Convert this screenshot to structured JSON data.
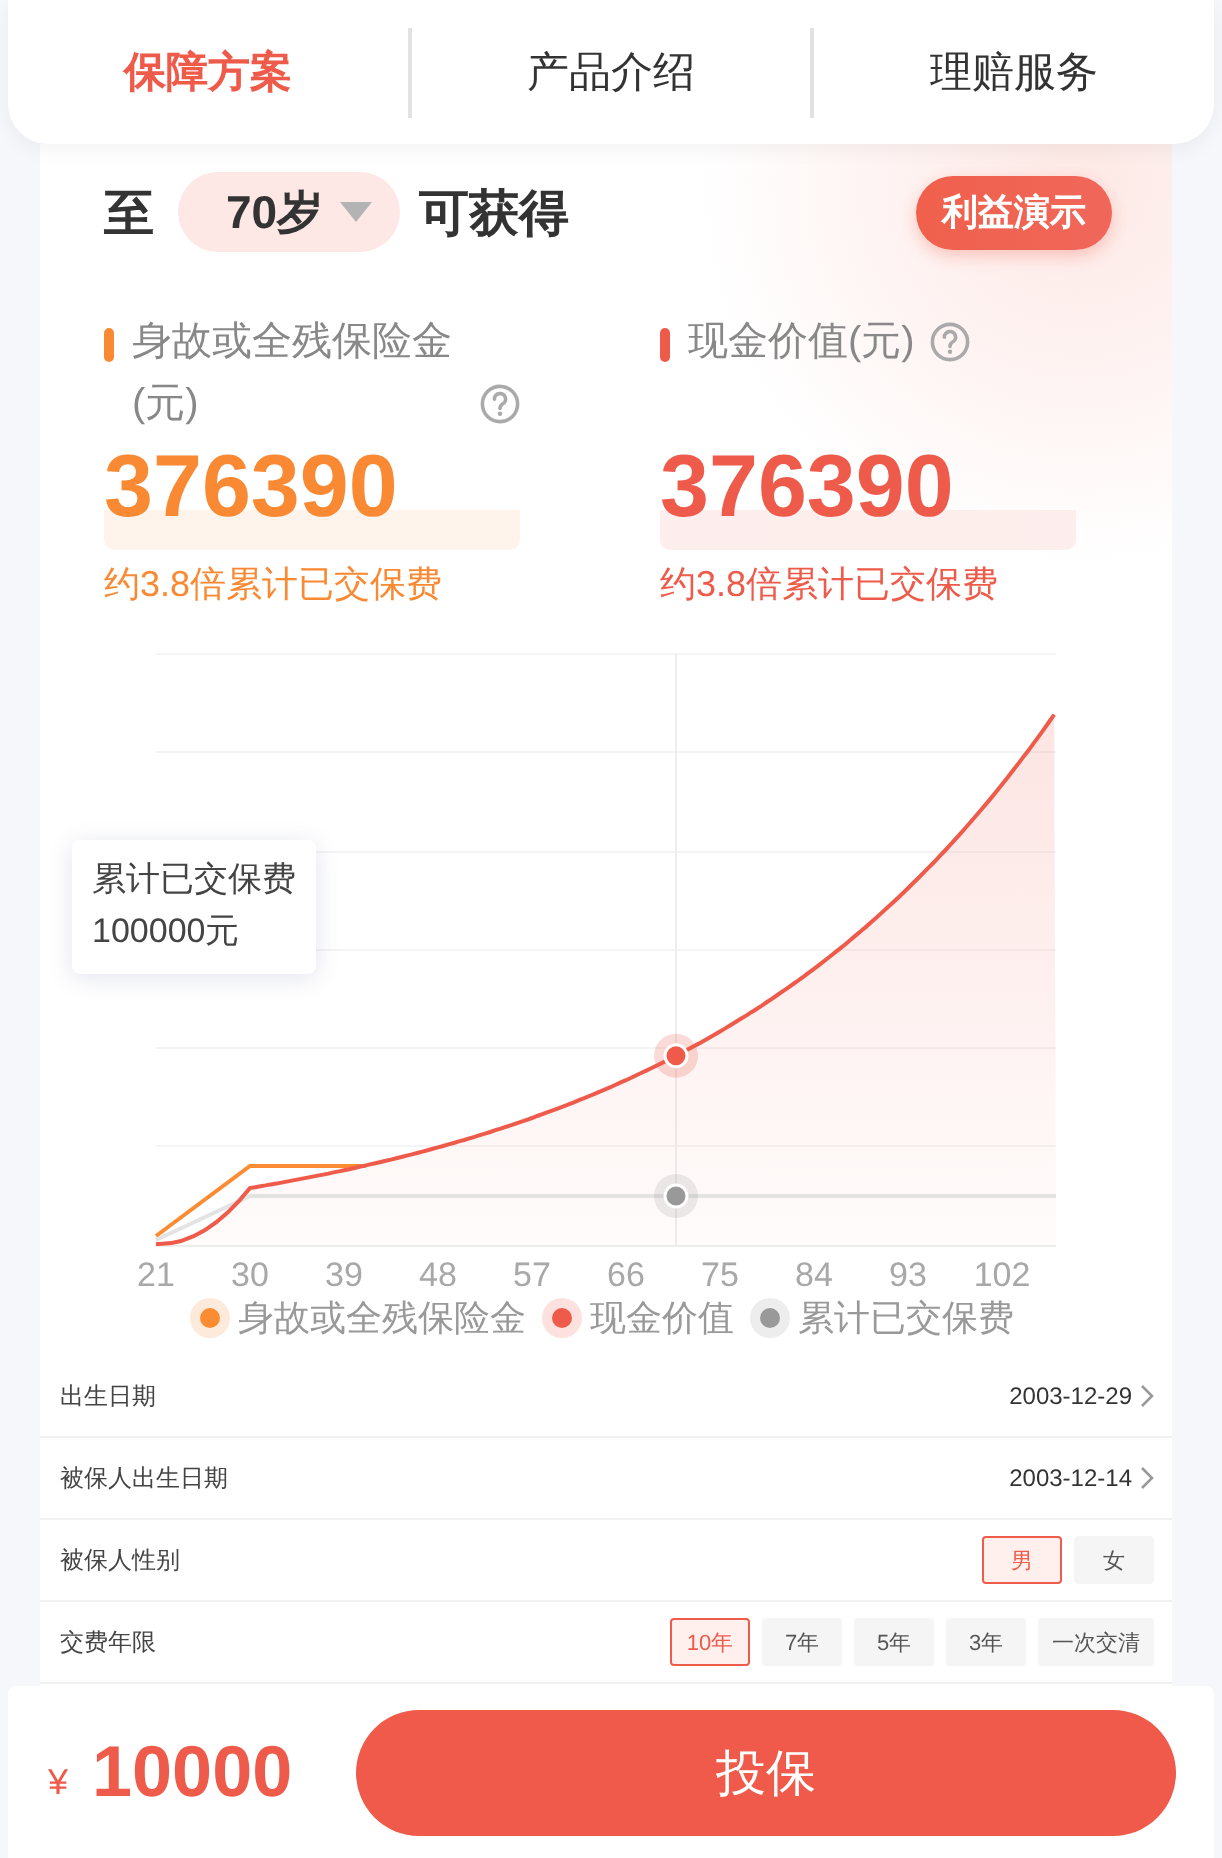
{
  "tabs": [
    {
      "label": "保障方案",
      "selected": true
    },
    {
      "label": "产品介绍",
      "selected": false
    },
    {
      "label": "理赔服务",
      "selected": false
    }
  ],
  "header": {
    "prefix": "至",
    "age": "70岁",
    "suffix": "可获得",
    "demo_button": "利益演示"
  },
  "metrics": [
    {
      "label": "身故或全残保险金(元)",
      "value": "376390",
      "note": "约3.8倍累计已交保费",
      "color": "#f98a33"
    },
    {
      "label": "现金价值(元)",
      "value": "376390",
      "note": "约3.8倍累计已交保费",
      "color": "#ef5b4b"
    }
  ],
  "chart": {
    "x_labels": [
      "21",
      "30",
      "39",
      "48",
      "57",
      "66",
      "75",
      "84",
      "93",
      "102"
    ],
    "tooltip": {
      "title": "累计已交保费",
      "value": "100000元"
    },
    "legend": [
      {
        "label": "身故或全残保险金",
        "color": "#fb8c34"
      },
      {
        "label": "现金价值",
        "color": "#ef5b4b"
      },
      {
        "label": "累计已交保费",
        "color": "#999999"
      }
    ]
  },
  "form": [
    {
      "kind": "link",
      "label": "出生日期",
      "value": "2003-12-29"
    },
    {
      "kind": "link",
      "label": "被保人出生日期",
      "value": "2003-12-14"
    },
    {
      "kind": "options",
      "label": "被保人性别",
      "options": [
        {
          "label": "男",
          "selected": true
        },
        {
          "label": "女",
          "selected": false
        }
      ]
    },
    {
      "kind": "options",
      "label": "交费年限",
      "options": [
        {
          "label": "10年",
          "selected": true
        },
        {
          "label": "7年",
          "selected": false
        },
        {
          "label": "5年",
          "selected": false
        },
        {
          "label": "3年",
          "selected": false
        },
        {
          "label": "一次交清",
          "selected": false
        }
      ]
    }
  ],
  "footer": {
    "currency": "¥",
    "price": "10000",
    "button": "投保"
  }
}
